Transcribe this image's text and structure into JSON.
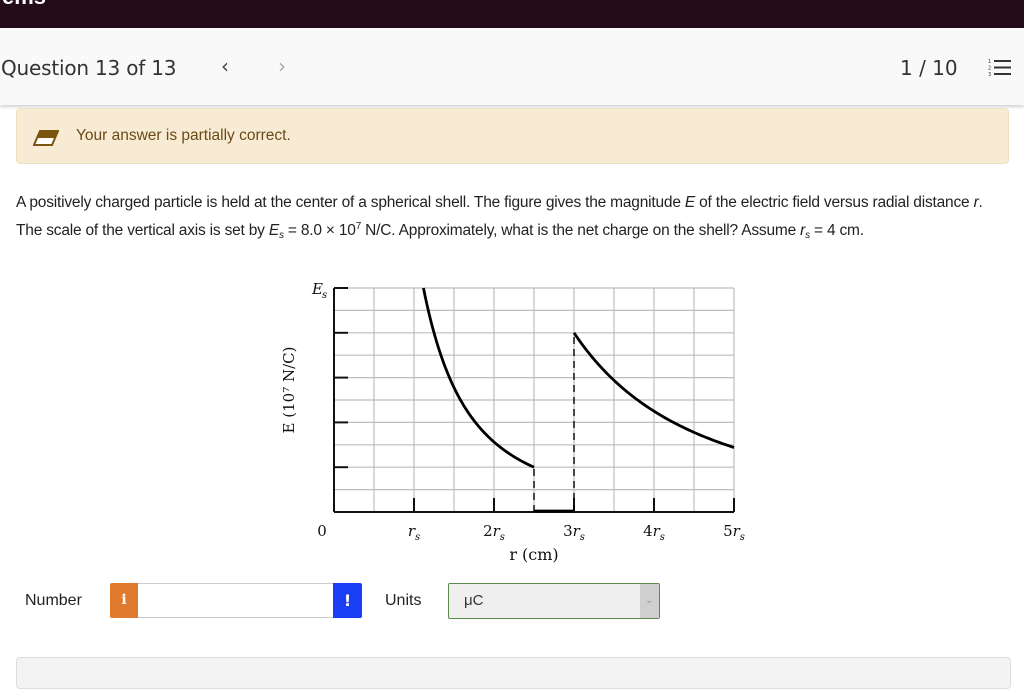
{
  "topbar": {
    "cut_text": "ems"
  },
  "header": {
    "question_title": "Question 13 of 13",
    "prev_icon": "chevron-left-icon",
    "next_icon": "chevron-right-icon",
    "prev_glyph": "‹",
    "next_glyph": "›",
    "page_count": "1 / 10",
    "list_icon": "numbered-list-icon"
  },
  "notice": {
    "icon": "eraser-icon",
    "message": "Your answer is partially correct.",
    "colors": {
      "background": "#f7ebd4",
      "text": "#6b4a16"
    }
  },
  "question": {
    "line1": "A positively charged particle is held at the center of a spherical shell. The figure gives the magnitude ",
    "E": "E",
    "line1b": " of the electric field versus radial distance ",
    "r": "r",
    "line1c": ". The scale of the vertical axis is set by ",
    "Es_E": "E",
    "Es_sub": "s",
    "line1d": " = 8.0 × 10",
    "exp": "7",
    "line1e": " N/C. Approximately, what is the net charge on the shell? Assume ",
    "rs_r": "r",
    "rs_sub": "s",
    "line1f": " = 4 cm."
  },
  "chart_data": {
    "type": "line",
    "title": "",
    "xlabel": "r (cm)",
    "ylabel": "E (10⁷ N/C)",
    "y_top_label": "Es",
    "x_tick_labels": [
      "0",
      "rs",
      "2rs",
      "3rs",
      "4rs",
      "5rs"
    ],
    "x_ticks": [
      0,
      1,
      2,
      3,
      4,
      5
    ],
    "xlim": [
      0,
      5
    ],
    "ylim": [
      0,
      1
    ],
    "y_units": "fraction of Es",
    "grid": true,
    "grid_x_step": 0.5,
    "grid_y_step": 0.1,
    "y_major_ticks": [
      0.2,
      0.4,
      0.6,
      0.8,
      1.0
    ],
    "series": [
      {
        "name": "inner field (1/r²)",
        "x": [
          1.118,
          1.25,
          1.5,
          1.75,
          2.0,
          2.25,
          2.5
        ],
        "y": [
          1.0,
          0.8,
          0.556,
          0.408,
          0.3125,
          0.247,
          0.2
        ]
      },
      {
        "name": "inside shell",
        "x": [
          2.5,
          3.0
        ],
        "y": [
          0,
          0
        ]
      },
      {
        "name": "outer field (1/r²)",
        "x": [
          3.0,
          3.5,
          4.0,
          4.5,
          5.0
        ],
        "y": [
          0.8,
          0.588,
          0.45,
          0.356,
          0.288
        ]
      }
    ],
    "dashed_verticals": [
      {
        "x": 2.5,
        "y_from": 0,
        "y_to": 0.2
      },
      {
        "x": 3.0,
        "y_from": 0,
        "y_to": 0.8
      }
    ]
  },
  "answer": {
    "number_label": "Number",
    "number_value": "",
    "info_icon": "info-icon",
    "info_glyph": "i",
    "warning_icon": "exclamation-icon",
    "warning_glyph": "!",
    "units_label": "Units",
    "units_selected": "μC",
    "dropdown_glyph": "⌄",
    "colors": {
      "info": "#e07b2e",
      "warning": "#1b3ff5",
      "select_border": "#5a8a4e"
    }
  }
}
